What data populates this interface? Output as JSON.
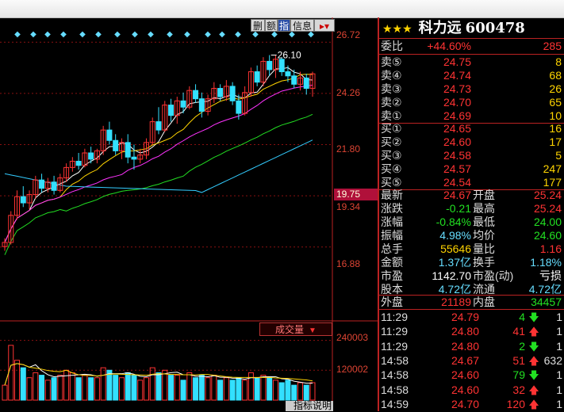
{
  "toolbar": {
    "buttons": [
      {
        "label": "删"
      },
      {
        "label": "额"
      },
      {
        "label": "指",
        "active": true
      },
      {
        "label": "信息"
      },
      {
        "label": "▸▾"
      }
    ]
  },
  "y_axis": {
    "price_ticks": [
      "26.72",
      "24.26",
      "21.80",
      "19.34",
      "16.88"
    ],
    "current_price_label": "19.75",
    "volume_ticks": [
      "240003",
      "120002"
    ]
  },
  "chart_annotation": "26.10",
  "volume_button_label": "成交量",
  "indicator_button_label": "指标说明",
  "chart_data": {
    "type": "candlestick",
    "ylim": [
      15.5,
      27.3
    ],
    "volume_ylim": [
      0,
      280000
    ],
    "candles": [
      [
        16.9,
        17.3,
        16.7,
        17.1
      ],
      [
        17.1,
        18.6,
        17.0,
        18.4
      ],
      [
        18.4,
        19.6,
        18.2,
        19.3
      ],
      [
        19.3,
        19.8,
        18.8,
        19.0
      ],
      [
        19.0,
        19.6,
        18.7,
        19.4
      ],
      [
        19.4,
        20.3,
        19.2,
        20.1
      ],
      [
        20.1,
        20.4,
        19.5,
        19.7
      ],
      [
        19.7,
        20.2,
        19.5,
        20.0
      ],
      [
        20.0,
        20.3,
        19.4,
        19.6
      ],
      [
        19.6,
        20.4,
        19.5,
        20.2
      ],
      [
        20.2,
        20.9,
        20.0,
        20.7
      ],
      [
        20.7,
        21.2,
        20.5,
        21.0
      ],
      [
        21.0,
        21.4,
        20.6,
        20.8
      ],
      [
        20.8,
        21.6,
        20.7,
        21.4
      ],
      [
        21.4,
        21.7,
        20.9,
        21.1
      ],
      [
        21.1,
        21.6,
        20.9,
        21.5
      ],
      [
        21.5,
        22.7,
        21.3,
        22.5
      ],
      [
        22.5,
        22.9,
        21.8,
        22.0
      ],
      [
        22.0,
        22.3,
        21.3,
        21.5
      ],
      [
        21.5,
        22.1,
        21.1,
        21.9
      ],
      [
        21.9,
        22.3,
        20.9,
        21.2
      ],
      [
        21.2,
        21.8,
        20.6,
        21.1
      ],
      [
        21.1,
        21.6,
        20.9,
        21.3
      ],
      [
        21.3,
        22.1,
        21.1,
        21.9
      ],
      [
        21.9,
        23.1,
        21.8,
        22.9
      ],
      [
        22.9,
        23.6,
        22.3,
        22.5
      ],
      [
        22.5,
        23.9,
        22.4,
        23.7
      ],
      [
        23.7,
        24.0,
        22.9,
        23.2
      ],
      [
        23.2,
        24.1,
        22.8,
        23.9
      ],
      [
        23.9,
        24.3,
        23.3,
        23.6
      ],
      [
        23.6,
        24.6,
        23.5,
        24.4
      ],
      [
        24.4,
        24.7,
        23.8,
        24.0
      ],
      [
        24.0,
        24.3,
        23.1,
        23.4
      ],
      [
        23.4,
        24.2,
        23.2,
        24.0
      ],
      [
        24.0,
        24.8,
        23.8,
        24.5
      ],
      [
        24.5,
        24.7,
        23.9,
        24.1
      ],
      [
        24.1,
        24.9,
        23.9,
        24.6
      ],
      [
        24.6,
        24.8,
        23.7,
        23.9
      ],
      [
        23.9,
        24.2,
        23.0,
        23.3
      ],
      [
        23.3,
        24.6,
        23.2,
        24.3
      ],
      [
        24.3,
        25.5,
        24.1,
        25.3
      ],
      [
        25.3,
        25.6,
        24.6,
        24.8
      ],
      [
        24.8,
        26.0,
        24.6,
        25.8
      ],
      [
        25.8,
        26.1,
        25.1,
        25.4
      ],
      [
        25.4,
        26.1,
        25.0,
        25.9
      ],
      [
        25.9,
        26.0,
        25.1,
        25.3
      ],
      [
        25.3,
        25.6,
        24.8,
        25.1
      ],
      [
        25.1,
        25.4,
        24.5,
        24.7
      ],
      [
        24.7,
        25.3,
        24.4,
        25.0
      ],
      [
        25.0,
        25.2,
        24.2,
        24.5
      ],
      [
        24.5,
        25.3,
        24.1,
        25.2
      ]
    ],
    "volume": [
      60000,
      220000,
      160000,
      130000,
      90000,
      110000,
      100000,
      80000,
      90000,
      100000,
      120000,
      110000,
      90000,
      100000,
      90000,
      90000,
      130000,
      120000,
      100000,
      90000,
      110000,
      100000,
      80000,
      90000,
      130000,
      110000,
      120000,
      100000,
      100000,
      80000,
      110000,
      90000,
      100000,
      90000,
      100000,
      80000,
      90000,
      80000,
      90000,
      80000,
      110000,
      90000,
      100000,
      90000,
      80000,
      70000,
      80000,
      60000,
      70000,
      60000,
      70000
    ],
    "ma_lines": [
      {
        "color": "#ffffff",
        "period": 5
      },
      {
        "color": "#ffd400",
        "period": 10
      },
      {
        "color": "#ff33ff",
        "period": 20
      },
      {
        "color": "#22dd22",
        "period": 30
      },
      {
        "color": "#33ccff",
        "period": 60
      }
    ]
  },
  "quote": {
    "stars": "★★★",
    "stock_name": "科力远",
    "stock_code": "600478",
    "commission": {
      "label": "委比",
      "pct": "+44.60%",
      "value": "285"
    },
    "asks": [
      {
        "label": "卖⑤",
        "price": "24.75",
        "vol": "8"
      },
      {
        "label": "卖④",
        "price": "24.74",
        "vol": "68"
      },
      {
        "label": "卖③",
        "price": "24.73",
        "vol": "26"
      },
      {
        "label": "卖②",
        "price": "24.70",
        "vol": "65"
      },
      {
        "label": "卖①",
        "price": "24.69",
        "vol": "10"
      }
    ],
    "bids": [
      {
        "label": "买①",
        "price": "24.65",
        "vol": "16"
      },
      {
        "label": "买②",
        "price": "24.60",
        "vol": "17"
      },
      {
        "label": "买③",
        "price": "24.58",
        "vol": "5"
      },
      {
        "label": "买④",
        "price": "24.57",
        "vol": "247"
      },
      {
        "label": "买⑤",
        "price": "24.54",
        "vol": "177"
      }
    ],
    "stats": [
      {
        "l1": "最新",
        "v1": "24.67",
        "c1": "red",
        "l2": "开盘",
        "v2": "25.24",
        "c2": "red"
      },
      {
        "l1": "涨跌",
        "v1": "-0.21",
        "c1": "grn",
        "l2": "最高",
        "v2": "25.24",
        "c2": "red"
      },
      {
        "l1": "涨幅",
        "v1": "-0.84%",
        "c1": "grn",
        "l2": "最低",
        "v2": "24.00",
        "c2": "grn"
      },
      {
        "l1": "振幅",
        "v1": "4.98%",
        "c1": "cyn",
        "l2": "均价",
        "v2": "24.60",
        "c2": "grn"
      },
      {
        "l1": "总手",
        "v1": "55646",
        "c1": "yel",
        "l2": "量比",
        "v2": "1.16",
        "c2": "red"
      },
      {
        "l1": "金额",
        "v1": "1.37亿",
        "c1": "cyn",
        "l2": "换手",
        "v2": "1.18%",
        "c2": "cyn"
      },
      {
        "l1": "市盈",
        "v1": "1142.70",
        "c1": "wht",
        "l2": "市盈(动)",
        "v2": "亏损",
        "c2": "wht"
      },
      {
        "l1": "股本",
        "v1": "4.72亿",
        "c1": "cyn",
        "l2": "流通",
        "v2": "4.72亿",
        "c2": "cyn"
      }
    ],
    "outer": {
      "l1": "外盘",
      "v1": "21189",
      "l2": "内盘",
      "v2": "34457"
    }
  },
  "ticks": [
    {
      "time": "11:29",
      "price": "24.79",
      "vol": "4",
      "dir": "down",
      "n": "1"
    },
    {
      "time": "11:29",
      "price": "24.80",
      "vol": "41",
      "dir": "up",
      "n": "1"
    },
    {
      "time": "11:29",
      "price": "24.80",
      "vol": "2",
      "dir": "down",
      "n": "1"
    },
    {
      "time": "14:58",
      "price": "24.67",
      "vol": "51",
      "dir": "up",
      "n": "632"
    },
    {
      "time": "14:58",
      "price": "24.60",
      "vol": "79",
      "dir": "down",
      "n": "1"
    },
    {
      "time": "14:58",
      "price": "24.60",
      "vol": "32",
      "dir": "up",
      "n": "1"
    },
    {
      "time": "14:59",
      "price": "24.70",
      "vol": "120",
      "dir": "up",
      "n": "1"
    }
  ]
}
